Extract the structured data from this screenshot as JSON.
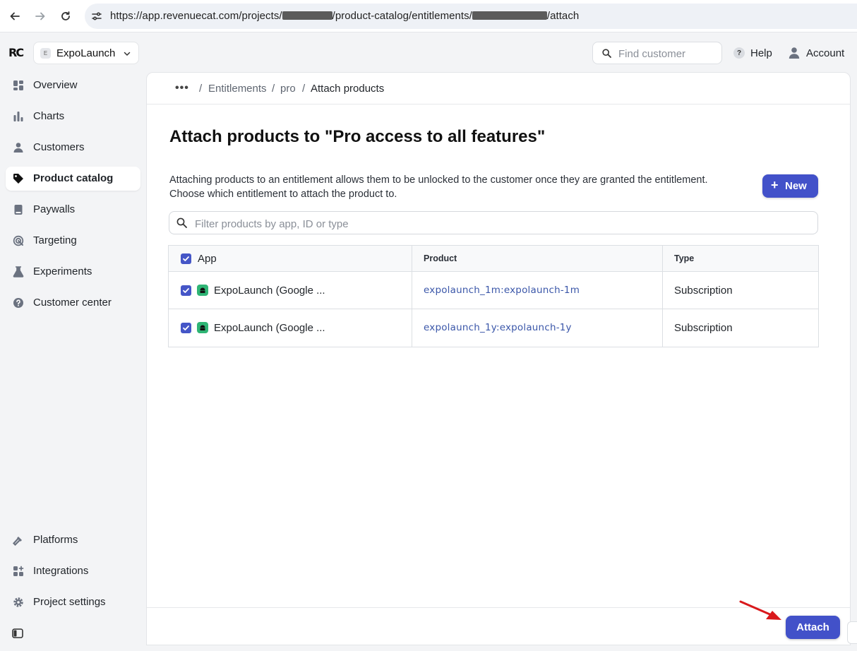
{
  "browser": {
    "url_prefix": "https://app.revenuecat.com/projects/",
    "url_middle": "/product-catalog/entitlements/",
    "url_suffix": "/attach"
  },
  "sidebar": {
    "logo": "RC",
    "project": {
      "badge": "E",
      "name": "ExpoLaunch"
    },
    "items": [
      {
        "label": "Overview",
        "icon": "overview-icon",
        "active": false
      },
      {
        "label": "Charts",
        "icon": "chart-icon",
        "active": false
      },
      {
        "label": "Customers",
        "icon": "person-icon",
        "active": false
      },
      {
        "label": "Product catalog",
        "icon": "tag-icon",
        "active": true
      },
      {
        "label": "Paywalls",
        "icon": "book-icon",
        "active": false
      },
      {
        "label": "Targeting",
        "icon": "target-icon",
        "active": false
      },
      {
        "label": "Experiments",
        "icon": "flask-icon",
        "active": false
      },
      {
        "label": "Customer center",
        "icon": "help-circle-icon",
        "active": false
      }
    ],
    "bottom_items": [
      {
        "label": "Platforms",
        "icon": "hammer-icon"
      },
      {
        "label": "Integrations",
        "icon": "integrations-icon"
      },
      {
        "label": "Project settings",
        "icon": "gear-icon"
      }
    ]
  },
  "topbar": {
    "search_placeholder": "Find customer",
    "help_label": "Help",
    "help_glyph": "?",
    "account_label": "Account"
  },
  "breadcrumb": {
    "more": "•••",
    "sep": "/",
    "items": [
      "Entitlements",
      "pro",
      "Attach products"
    ]
  },
  "main": {
    "title": "Attach products to \"Pro access to all features\"",
    "desc_line1": "Attaching products to an entitlement allows them to be unlocked to the customer once they are granted the entitlement.",
    "desc_line2": "Choose which entitlement to attach the product to.",
    "new_label": "New",
    "new_plus": "+",
    "filter_placeholder": "Filter products by app, ID or type"
  },
  "table": {
    "headers": {
      "app": "App",
      "product": "Product",
      "type": "Type"
    },
    "rows": [
      {
        "app": "ExpoLaunch (Google ...",
        "product": "expolaunch_1m:expolaunch-1m",
        "type": "Subscription",
        "checked": true
      },
      {
        "app": "ExpoLaunch (Google ...",
        "product": "expolaunch_1y:expolaunch-1y",
        "type": "Subscription",
        "checked": true
      }
    ]
  },
  "footer": {
    "attach_label": "Attach"
  },
  "colors": {
    "accent": "#4251c9",
    "link": "#3b57a9",
    "android": "#2fb575",
    "annotation_arrow": "#d9191c"
  }
}
